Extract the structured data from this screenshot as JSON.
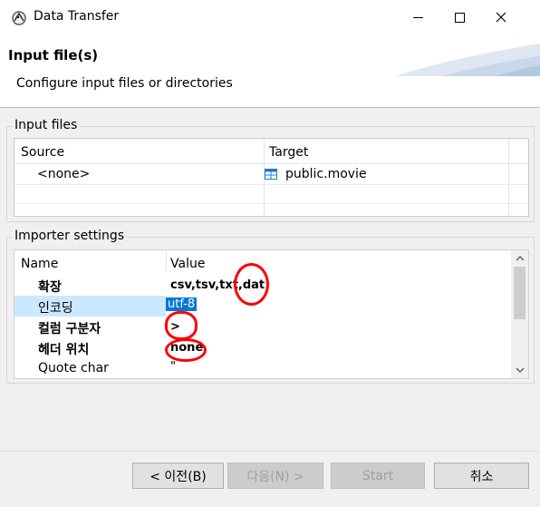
{
  "window": {
    "title": "Data Transfer",
    "app_icon": "dbeaver-beaver-icon",
    "minimize_icon": "minimize-icon",
    "maximize_icon": "maximize-icon",
    "close_icon": "close-icon"
  },
  "header": {
    "heading": "Input file(s)",
    "description": "Configure input files or directories"
  },
  "input_files": {
    "group_label": "Input files",
    "columns": [
      "Source",
      "Target"
    ],
    "rows": [
      {
        "source": "<none>",
        "target": "public.movie",
        "target_icon": "table-icon"
      }
    ]
  },
  "importer_settings": {
    "group_label": "Importer settings",
    "columns": [
      "Name",
      "Value"
    ],
    "rows": [
      {
        "name": "확장",
        "value": "csv,tsv,txt,dat",
        "bold": true
      },
      {
        "name": "인코딩",
        "value": "utf-8",
        "bold": false,
        "selected": true
      },
      {
        "name": "컬럼 구분자",
        "value": ">",
        "bold": true
      },
      {
        "name": "헤더 위치",
        "value": "none",
        "bold": true
      },
      {
        "name": "Quote char",
        "value": "\"",
        "bold": false
      }
    ]
  },
  "buttons": {
    "back": "< 이전(B)",
    "next": "다음(N) >",
    "start": "Start",
    "cancel": "취소"
  },
  "colors": {
    "selection_row": "#cce8ff",
    "selection_value": "#0078d7",
    "annotation": "#ff0000",
    "banner_accent": "#d6e3f1"
  }
}
